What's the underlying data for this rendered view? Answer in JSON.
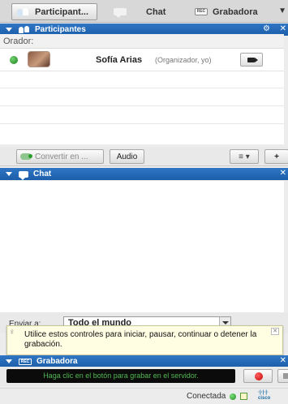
{
  "tabs": [
    {
      "label": "Participant...",
      "icon": "people-icon"
    },
    {
      "label": "Chat",
      "icon": "chat-bubble-icon"
    },
    {
      "label": "Grabadora",
      "icon": "rec-icon",
      "badge": "REC"
    }
  ],
  "participants_panel": {
    "title": "Participantes",
    "role_group": "Orador:",
    "participant": {
      "name": "Sofía Arias",
      "role": "(Organizador, yo)"
    },
    "toolbar": {
      "convert_label": "Convertir en ...",
      "audio_label": "Audio",
      "list_label": "≡ ▾",
      "add_label": "+"
    }
  },
  "chat_panel": {
    "title": "Chat",
    "send_to_label": "Enviar a:",
    "send_to_value": "Todo el mundo"
  },
  "tooltip": {
    "text": "Utilice estos controles para iniciar, pausar, continuar o detener la grabación."
  },
  "recorder_panel": {
    "title": "Grabadora",
    "badge": "REC",
    "status_text": "Haga clic en el botón para grabar en el servidor."
  },
  "status_bar": {
    "connection": "Conectada",
    "logo_top": "·|·|·|·",
    "logo_bottom": "cisco"
  },
  "colors": {
    "header_blue": "#1c5ea9",
    "status_green": "#1e7d1e",
    "record_red": "#c80000"
  }
}
